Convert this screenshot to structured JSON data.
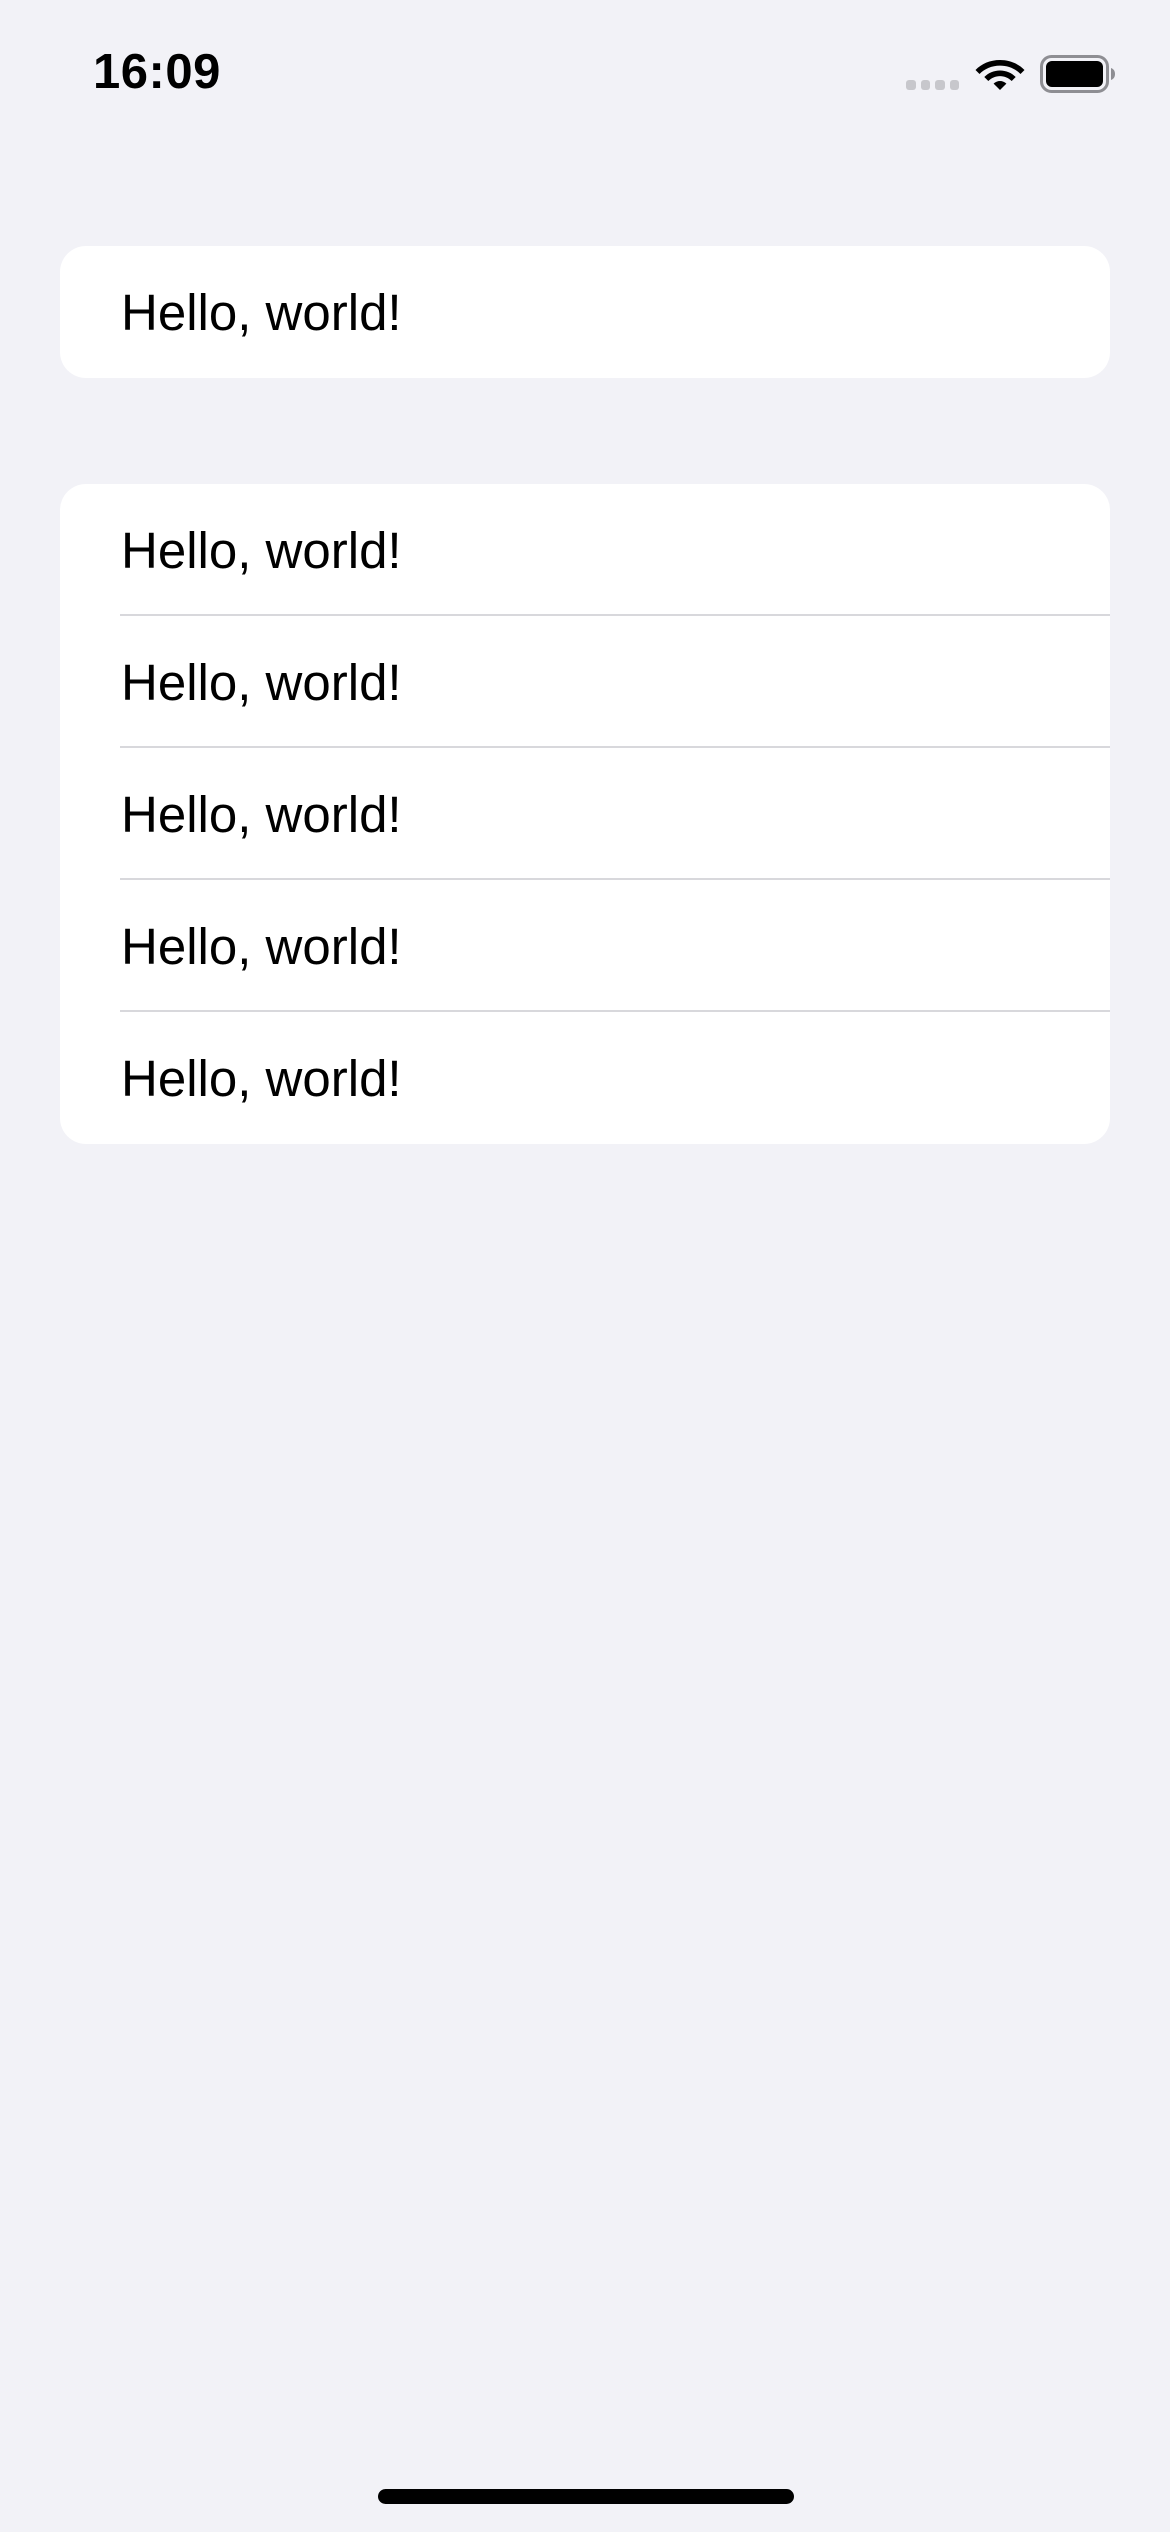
{
  "status_bar": {
    "time": "16:09",
    "signal_icon": "cellular-signal-icon",
    "wifi_icon": "wifi-icon",
    "battery_icon": "battery-icon"
  },
  "list": {
    "section_1": {
      "rows": [
        {
          "label": "Hello, world!"
        }
      ]
    },
    "section_2": {
      "rows": [
        {
          "label": "Hello, world!"
        },
        {
          "label": "Hello, world!"
        },
        {
          "label": "Hello, world!"
        },
        {
          "label": "Hello, world!"
        },
        {
          "label": "Hello, world!"
        }
      ]
    }
  },
  "colors": {
    "background": "#F2F2F7",
    "cell_background": "#FFFFFF",
    "separator": "#D8D8DC",
    "text": "#000000"
  }
}
